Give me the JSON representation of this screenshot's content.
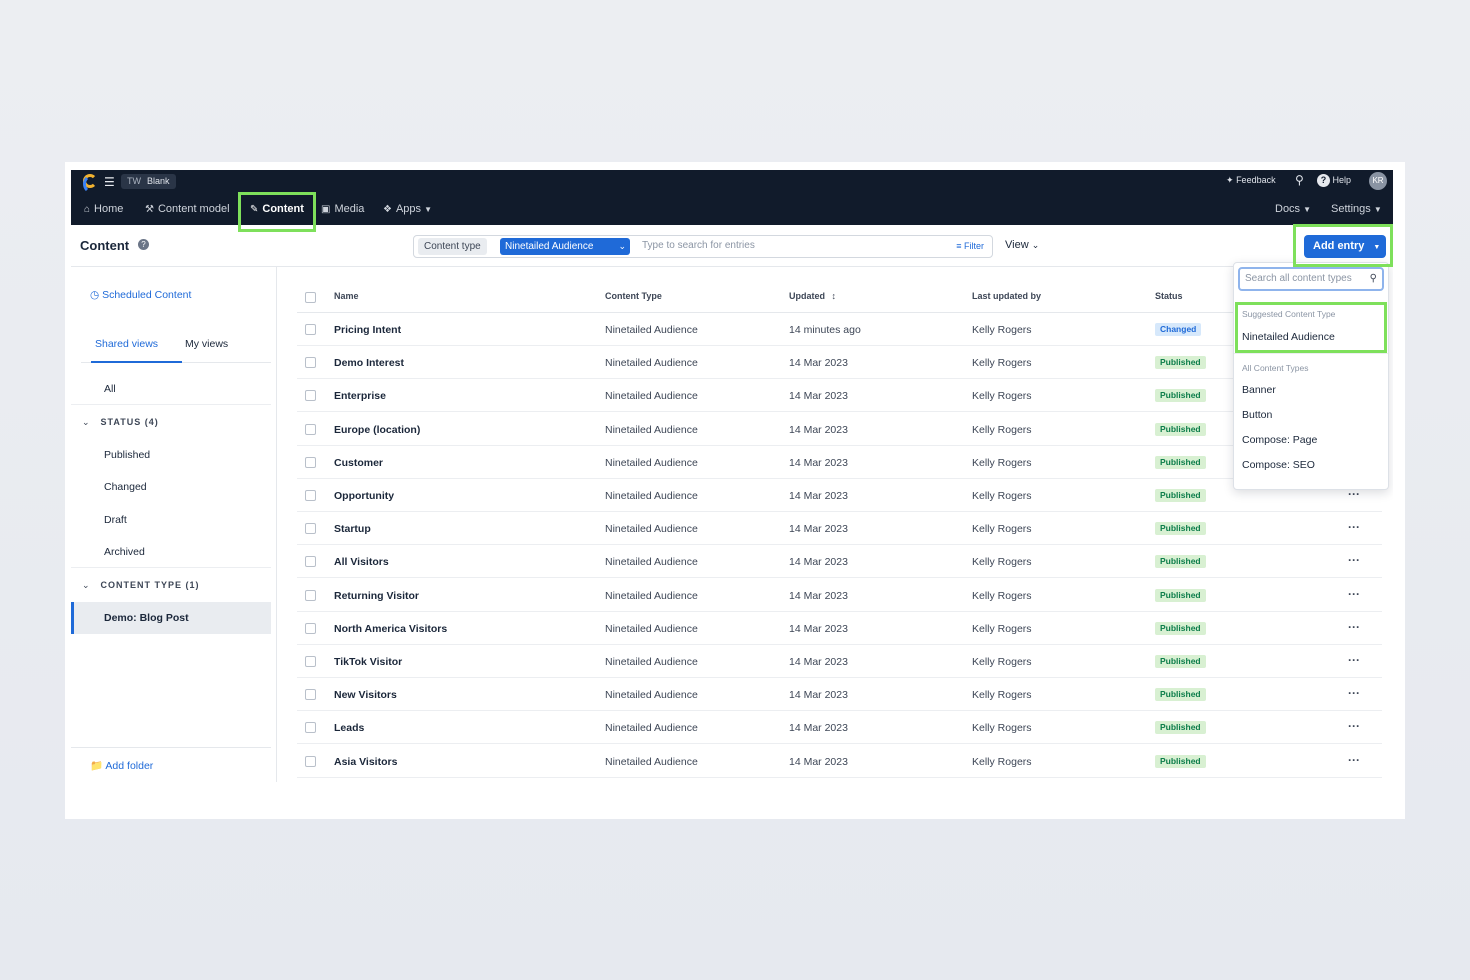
{
  "topbar": {
    "space_env": "TW",
    "space_name": "Blank",
    "feedback": "Feedback",
    "help": "Help",
    "avatar_initials": "KR"
  },
  "nav": {
    "home": "Home",
    "content_model": "Content model",
    "content": "Content",
    "media": "Media",
    "apps": "Apps",
    "docs": "Docs",
    "settings": "Settings"
  },
  "toolbar": {
    "title": "Content",
    "content_type_label": "Content type",
    "content_type_value": "Ninetailed Audience",
    "search_placeholder": "Type to search for entries",
    "filter": "Filter",
    "view": "View",
    "add_entry": "Add entry"
  },
  "sidebar": {
    "scheduled": "Scheduled Content",
    "tab_shared": "Shared views",
    "tab_mine": "My views",
    "all": "All",
    "status_section": "STATUS (4)",
    "status_items": [
      "Published",
      "Changed",
      "Draft",
      "Archived"
    ],
    "content_type_section": "CONTENT TYPE (1)",
    "content_type_items": [
      "Demo: Blog Post"
    ],
    "add_folder": "Add folder"
  },
  "table": {
    "headers": {
      "name": "Name",
      "content_type": "Content Type",
      "updated": "Updated",
      "last_updated_by": "Last updated by",
      "status": "Status"
    },
    "rows": [
      {
        "name": "Pricing Intent",
        "type": "Ninetailed Audience",
        "updated": "14 minutes ago",
        "by": "Kelly Rogers",
        "status": "Changed"
      },
      {
        "name": "Demo Interest",
        "type": "Ninetailed Audience",
        "updated": "14 Mar 2023",
        "by": "Kelly Rogers",
        "status": "Published"
      },
      {
        "name": "Enterprise",
        "type": "Ninetailed Audience",
        "updated": "14 Mar 2023",
        "by": "Kelly Rogers",
        "status": "Published"
      },
      {
        "name": "Europe (location)",
        "type": "Ninetailed Audience",
        "updated": "14 Mar 2023",
        "by": "Kelly Rogers",
        "status": "Published"
      },
      {
        "name": "Customer",
        "type": "Ninetailed Audience",
        "updated": "14 Mar 2023",
        "by": "Kelly Rogers",
        "status": "Published"
      },
      {
        "name": "Opportunity",
        "type": "Ninetailed Audience",
        "updated": "14 Mar 2023",
        "by": "Kelly Rogers",
        "status": "Published"
      },
      {
        "name": "Startup",
        "type": "Ninetailed Audience",
        "updated": "14 Mar 2023",
        "by": "Kelly Rogers",
        "status": "Published"
      },
      {
        "name": "All Visitors",
        "type": "Ninetailed Audience",
        "updated": "14 Mar 2023",
        "by": "Kelly Rogers",
        "status": "Published"
      },
      {
        "name": "Returning Visitor",
        "type": "Ninetailed Audience",
        "updated": "14 Mar 2023",
        "by": "Kelly Rogers",
        "status": "Published"
      },
      {
        "name": "North America Visitors",
        "type": "Ninetailed Audience",
        "updated": "14 Mar 2023",
        "by": "Kelly Rogers",
        "status": "Published"
      },
      {
        "name": "TikTok Visitor",
        "type": "Ninetailed Audience",
        "updated": "14 Mar 2023",
        "by": "Kelly Rogers",
        "status": "Published"
      },
      {
        "name": "New Visitors",
        "type": "Ninetailed Audience",
        "updated": "14 Mar 2023",
        "by": "Kelly Rogers",
        "status": "Published"
      },
      {
        "name": "Leads",
        "type": "Ninetailed Audience",
        "updated": "14 Mar 2023",
        "by": "Kelly Rogers",
        "status": "Published"
      },
      {
        "name": "Asia Visitors",
        "type": "Ninetailed Audience",
        "updated": "14 Mar 2023",
        "by": "Kelly Rogers",
        "status": "Published"
      }
    ]
  },
  "dropdown": {
    "search_placeholder": "Search all content types",
    "suggested_label": "Suggested Content Type",
    "suggested_item": "Ninetailed Audience",
    "all_label": "All Content Types",
    "all_items": [
      "Banner",
      "Button",
      "Compose: Page",
      "Compose: SEO"
    ]
  },
  "colors": {
    "nav_bg": "#111b2b",
    "accent": "#1f6ad8",
    "highlight": "#7ee05b",
    "published_bg": "#d8f0d2",
    "changed_bg": "#d6e8fb"
  }
}
